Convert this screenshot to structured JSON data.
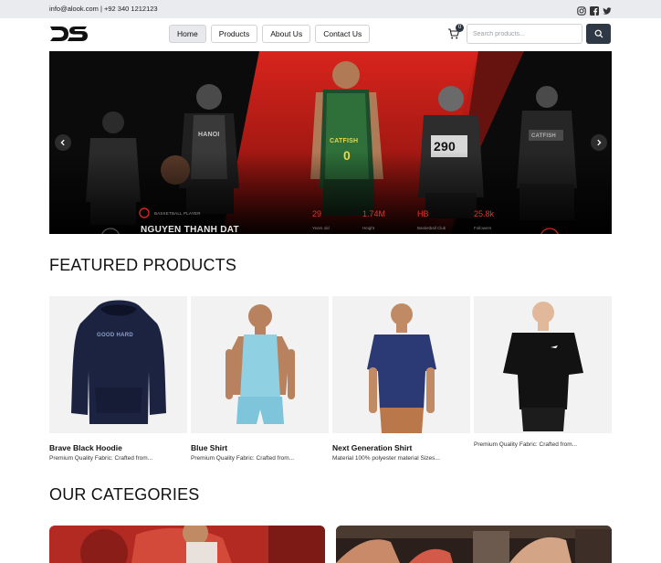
{
  "topbar": {
    "contact": "info@alook.com | +92 340 1212123",
    "social_icons": [
      "instagram-icon",
      "facebook-icon",
      "twitter-icon"
    ]
  },
  "header": {
    "logo_text": "DS",
    "nav": [
      "Home",
      "Products",
      "About Us",
      "Contact Us"
    ],
    "active_nav": "Home",
    "cart_count": "0",
    "search_placeholder": "Search products..."
  },
  "hero": {
    "label": "BASKETBALL PLAYER",
    "player_name": "NGUYEN THANH DAT",
    "stats": [
      {
        "value": "29",
        "label": "Years old"
      },
      {
        "value": "1.74M",
        "label": "Height"
      },
      {
        "value": "HB",
        "label": "Basketball Club"
      },
      {
        "value": "25.8k",
        "label": "Followers"
      }
    ],
    "jersey_numbers": [
      "290",
      "0"
    ],
    "jersey_text": [
      "HANOI",
      "CATFISH",
      "CATFISH"
    ]
  },
  "featured": {
    "title": "FEATURED PRODUCTS",
    "products": [
      {
        "name": "Brave Black Hoodie",
        "desc": "Premium Quality Fabric: Crafted from...",
        "print": "GOOD HARD"
      },
      {
        "name": "Blue Shirt",
        "desc": "Premium Quality Fabric: Crafted from..."
      },
      {
        "name": "Next Generation Shirt",
        "desc": "Material 100% polyester material Sizes..."
      },
      {
        "name": "",
        "desc": "Premium Quality Fabric: Crafted from..."
      }
    ]
  },
  "categories": {
    "title": "OUR CATEGORIES"
  },
  "colors": {
    "accent": "#e0362c",
    "dark_button": "#2f3945",
    "hero_bg": "#0b0b0b"
  }
}
